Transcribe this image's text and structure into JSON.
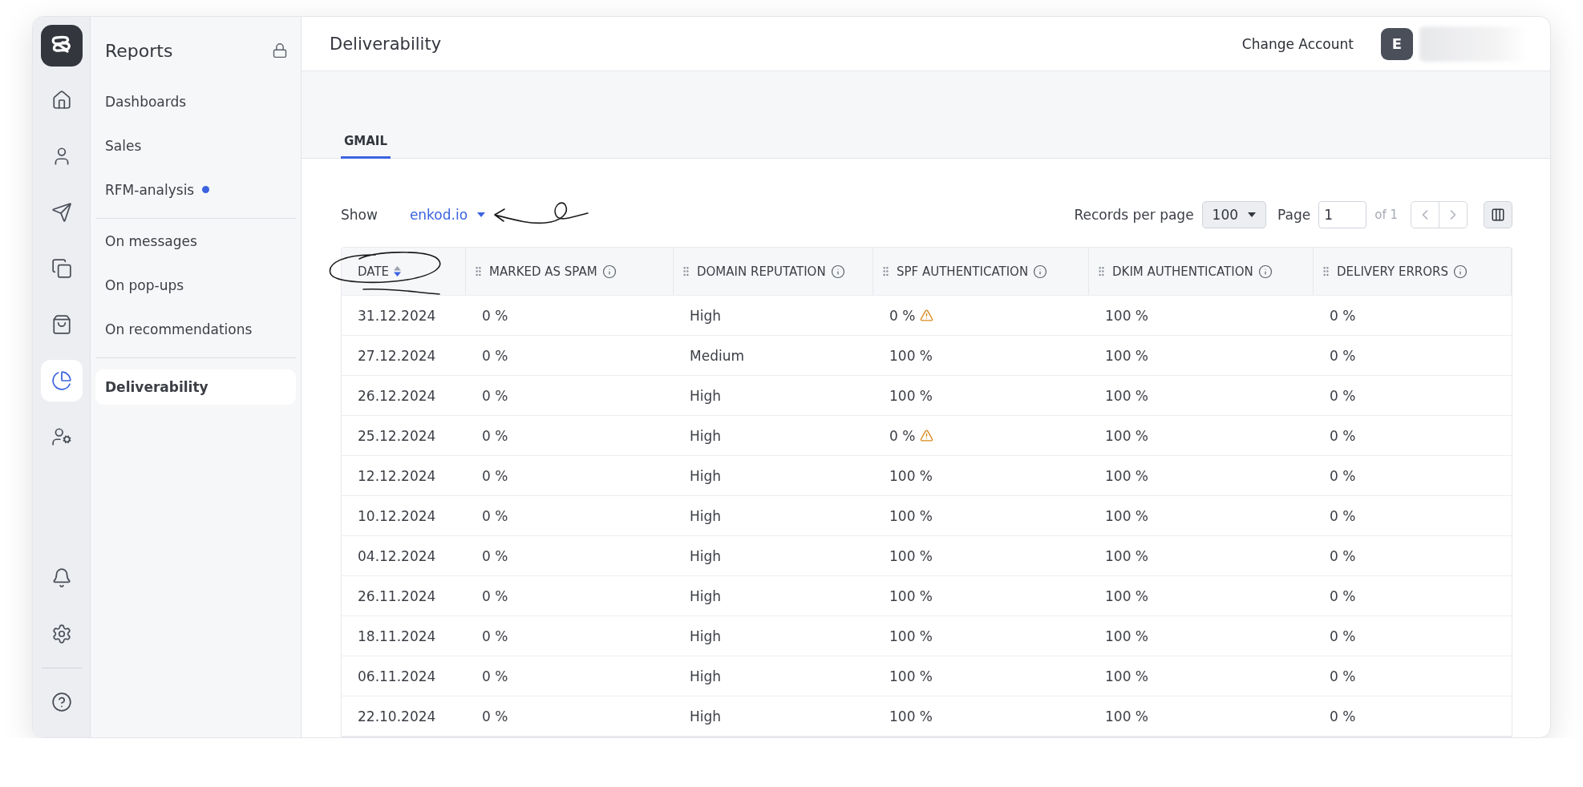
{
  "rail": {
    "items": [
      {
        "kind": "home",
        "selected": false
      },
      {
        "kind": "user",
        "selected": false
      },
      {
        "kind": "send",
        "selected": false
      },
      {
        "kind": "copy",
        "selected": false
      },
      {
        "kind": "bag",
        "selected": false
      },
      {
        "kind": "pie",
        "selected": true
      },
      {
        "kind": "user-settings",
        "selected": false
      }
    ],
    "bottom": [
      {
        "kind": "bell"
      },
      {
        "kind": "settings"
      },
      {
        "kind": "help"
      }
    ]
  },
  "sidebar": {
    "title": "Reports",
    "locked": true,
    "groups": [
      [
        {
          "label": "Dashboards",
          "dot": false,
          "selected": false
        },
        {
          "label": "Sales",
          "dot": false,
          "selected": false
        },
        {
          "label": "RFM-analysis",
          "dot": true,
          "selected": false
        }
      ],
      [
        {
          "label": "On messages",
          "dot": false,
          "selected": false
        },
        {
          "label": "On pop-ups",
          "dot": false,
          "selected": false
        },
        {
          "label": "On recommendations",
          "dot": false,
          "selected": false
        }
      ],
      [
        {
          "label": "Deliverability",
          "dot": false,
          "selected": true
        }
      ]
    ]
  },
  "header": {
    "title": "Deliverability",
    "change_account": "Change Account",
    "avatar": "E"
  },
  "tabs": [
    {
      "label": "GMAIL",
      "selected": true
    }
  ],
  "toolbar": {
    "show_label": "Show",
    "domain": "enkod.io",
    "records_label": "Records per page",
    "records_value": "100",
    "page_label": "Page",
    "page_value": "1",
    "page_of": "of 1",
    "prev_disabled": true,
    "next_disabled": true
  },
  "table": {
    "columns": [
      {
        "label": "DATE",
        "kind": "sort"
      },
      {
        "label": "MARKED AS SPAM",
        "kind": "info"
      },
      {
        "label": "DOMAIN REPUTATION",
        "kind": "info"
      },
      {
        "label": "SPF AUTHENTICATION",
        "kind": "info"
      },
      {
        "label": "DKIM AUTHENTICATION",
        "kind": "info"
      },
      {
        "label": "DELIVERY ERRORS",
        "kind": "info"
      }
    ],
    "rows": [
      {
        "date": "31.12.2024",
        "spam": "0 %",
        "reputation": "High",
        "spf": "0 %",
        "spf_warning": true,
        "dkim": "100 %",
        "errors": "0 %"
      },
      {
        "date": "27.12.2024",
        "spam": "0 %",
        "reputation": "Medium",
        "spf": "100 %",
        "spf_warning": false,
        "dkim": "100 %",
        "errors": "0 %"
      },
      {
        "date": "26.12.2024",
        "spam": "0 %",
        "reputation": "High",
        "spf": "100 %",
        "spf_warning": false,
        "dkim": "100 %",
        "errors": "0 %"
      },
      {
        "date": "25.12.2024",
        "spam": "0 %",
        "reputation": "High",
        "spf": "0 %",
        "spf_warning": true,
        "dkim": "100 %",
        "errors": "0 %"
      },
      {
        "date": "12.12.2024",
        "spam": "0 %",
        "reputation": "High",
        "spf": "100 %",
        "spf_warning": false,
        "dkim": "100 %",
        "errors": "0 %"
      },
      {
        "date": "10.12.2024",
        "spam": "0 %",
        "reputation": "High",
        "spf": "100 %",
        "spf_warning": false,
        "dkim": "100 %",
        "errors": "0 %"
      },
      {
        "date": "04.12.2024",
        "spam": "0 %",
        "reputation": "High",
        "spf": "100 %",
        "spf_warning": false,
        "dkim": "100 %",
        "errors": "0 %"
      },
      {
        "date": "26.11.2024",
        "spam": "0 %",
        "reputation": "High",
        "spf": "100 %",
        "spf_warning": false,
        "dkim": "100 %",
        "errors": "0 %"
      },
      {
        "date": "18.11.2024",
        "spam": "0 %",
        "reputation": "High",
        "spf": "100 %",
        "spf_warning": false,
        "dkim": "100 %",
        "errors": "0 %"
      },
      {
        "date": "06.11.2024",
        "spam": "0 %",
        "reputation": "High",
        "spf": "100 %",
        "spf_warning": false,
        "dkim": "100 %",
        "errors": "0 %"
      },
      {
        "date": "22.10.2024",
        "spam": "0 %",
        "reputation": "High",
        "spf": "100 %",
        "spf_warning": false,
        "dkim": "100 %",
        "errors": "0 %"
      }
    ]
  }
}
